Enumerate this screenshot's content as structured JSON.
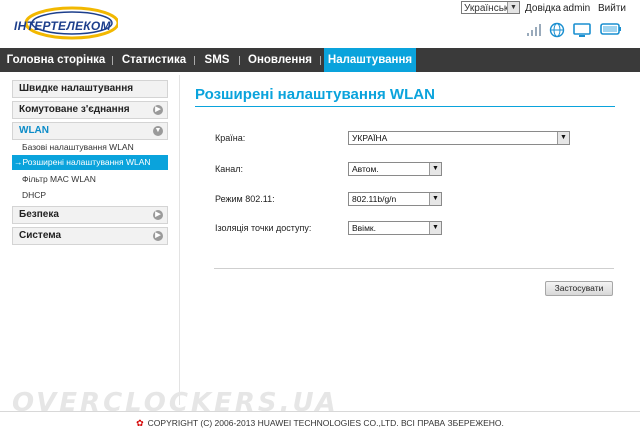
{
  "header": {
    "logo_text": "ІНТЕРТЕЛЕКОМ",
    "language": "Українська",
    "links": {
      "help": "Довідка",
      "user": "admin",
      "logout": "Вийти"
    },
    "status_icons": [
      "signal-icon",
      "globe-icon",
      "monitor-icon",
      "battery-icon"
    ]
  },
  "nav": {
    "items": [
      {
        "label": "Головна сторінка"
      },
      {
        "label": "Статистика"
      },
      {
        "label": "SMS"
      },
      {
        "label": "Оновлення"
      },
      {
        "label": "Налаштування",
        "active": true
      }
    ]
  },
  "sidebar": {
    "quick_setup": "Швидке налаштування",
    "dialup": "Комутоване з'єднання",
    "wlan": "WLAN",
    "wlan_items": [
      "Базові налаштування WLAN",
      "→Розширені налаштування WLAN",
      "Фільтр MAC WLAN",
      "DHCP"
    ],
    "security": "Безпека",
    "system": "Система"
  },
  "main": {
    "title": "Розширені налаштування WLAN",
    "fields": {
      "country": {
        "label": "Країна:",
        "value": "УКРАЇНА"
      },
      "channel": {
        "label": "Канал:",
        "value": "Автом."
      },
      "mode": {
        "label": "Режим 802.11:",
        "value": "802.11b/g/n"
      },
      "isolation": {
        "label": "Ізоляція точки доступу:",
        "value": "Ввімк."
      }
    },
    "apply_label": "Застосувати"
  },
  "footer": {
    "copyright": "COPYRIGHT (C) 2006-2013 HUAWEI TECHNOLOGIES CO.,LTD. ВСІ ПРАВА ЗБЕРЕЖЕНО.",
    "watermark": "OVERCLOCKERS.UA"
  },
  "colors": {
    "accent": "#0aa3dc",
    "nav_bg": "#3a3a3a"
  }
}
